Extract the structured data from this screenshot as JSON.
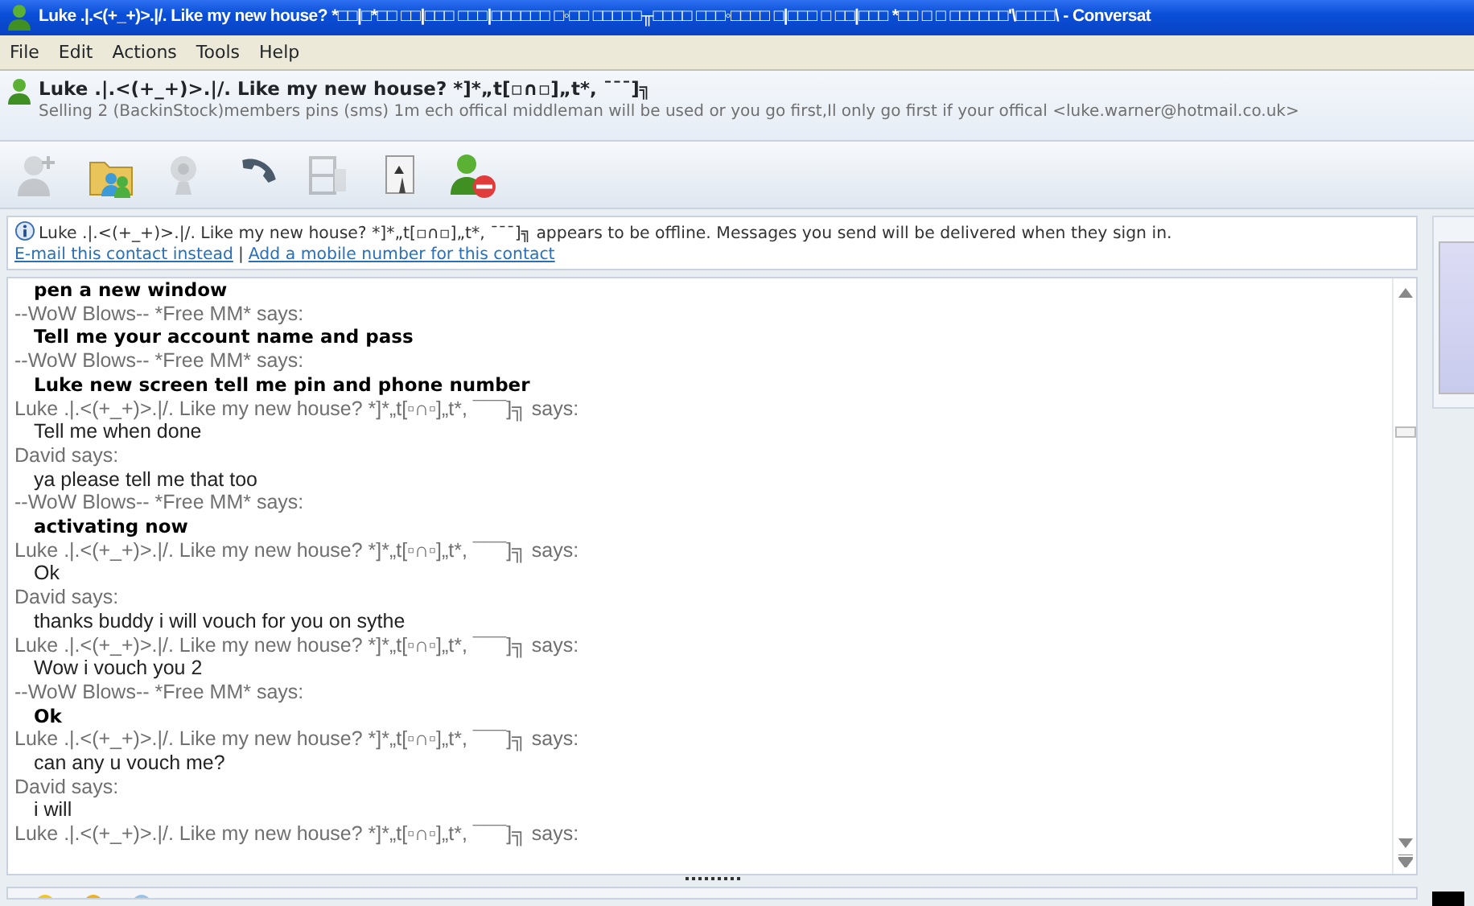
{
  "window": {
    "title": "Luke .|.<(+_+)>.|/. Like my new house? *□□|□*□□ □□|□□□ □□□|□□□□□□ □◦□□ □□□□□╥□□□□ □□□◦□□□□ □|□□□ □ □□|□□□ *□□   □ □ □□□□□□'\\□□□□\\ - Conversat"
  },
  "menu": [
    "File",
    "Edit",
    "Actions",
    "Tools",
    "Help"
  ],
  "contact": {
    "name": "Luke .|.<(+_+)>.|/. Like my new house? *]*„t[▫∩▫]„t*, ¯¯¯]╗",
    "status": "Selling 2 (BackinStock)members pins (sms) 1m ech offical middleman will be used or you go first,Il only go first if your offical <luke.warner@hotmail.co.uk>"
  },
  "toolbar": [
    {
      "kind": "invite",
      "disabled": true
    },
    {
      "kind": "share",
      "disabled": false
    },
    {
      "kind": "webcam",
      "disabled": true
    },
    {
      "kind": "call",
      "disabled": false
    },
    {
      "kind": "video",
      "disabled": true
    },
    {
      "kind": "game",
      "disabled": false
    },
    {
      "kind": "block",
      "disabled": false
    }
  ],
  "notice": {
    "text": "Luke .|.<(+_+)>.|/. Like my new house? *]*„t[▫∩▫]„t*, ¯¯¯]╗ appears to be offline. Messages you send will be delivered when they sign in.",
    "links": [
      "E-mail this contact instead",
      "Add a mobile number for this contact"
    ],
    "separator": "|"
  },
  "messages": [
    {
      "text": "pen a new window",
      "bold": true
    },
    {
      "sender": "--WoW Blows-- *Free MM* says:",
      "text": "Tell me your account name and pass",
      "bold": true
    },
    {
      "sender": "--WoW Blows-- *Free MM* says:",
      "text": "Luke new screen tell me pin and phone number",
      "bold": true
    },
    {
      "sender": "Luke .|.<(+_+)>.|/. Like my new house? *]*„t[▫∩▫]„t*, ¯¯¯]╗ says:",
      "text": "Tell me when done",
      "bold": false
    },
    {
      "sender": "David says:",
      "text": "ya please tell me that too",
      "bold": false
    },
    {
      "sender": "--WoW Blows-- *Free MM* says:",
      "text": "activating now",
      "bold": true
    },
    {
      "sender": "Luke .|.<(+_+)>.|/. Like my new house? *]*„t[▫∩▫]„t*, ¯¯¯]╗ says:",
      "text": "Ok",
      "bold": false
    },
    {
      "sender": "David says:",
      "text": "thanks buddy i will vouch for you on sythe",
      "bold": false
    },
    {
      "sender": "Luke .|.<(+_+)>.|/. Like my new house? *]*„t[▫∩▫]„t*, ¯¯¯]╗ says:",
      "text": "Wow i vouch you 2",
      "bold": false
    },
    {
      "sender": "--WoW Blows-- *Free MM* says:",
      "text": "Ok",
      "bold": true
    },
    {
      "sender": "Luke .|.<(+_+)>.|/. Like my new house? *]*„t[▫∩▫]„t*, ¯¯¯]╗ says:",
      "text": "can any u vouch me?",
      "bold": false
    },
    {
      "sender": "David says:",
      "text": "i will",
      "bold": false
    },
    {
      "sender": "Luke .|.<(+_+)>.|/. Like my new house? *]*„t[▫∩▫]„t*, ¯¯¯]╗ says:"
    }
  ]
}
